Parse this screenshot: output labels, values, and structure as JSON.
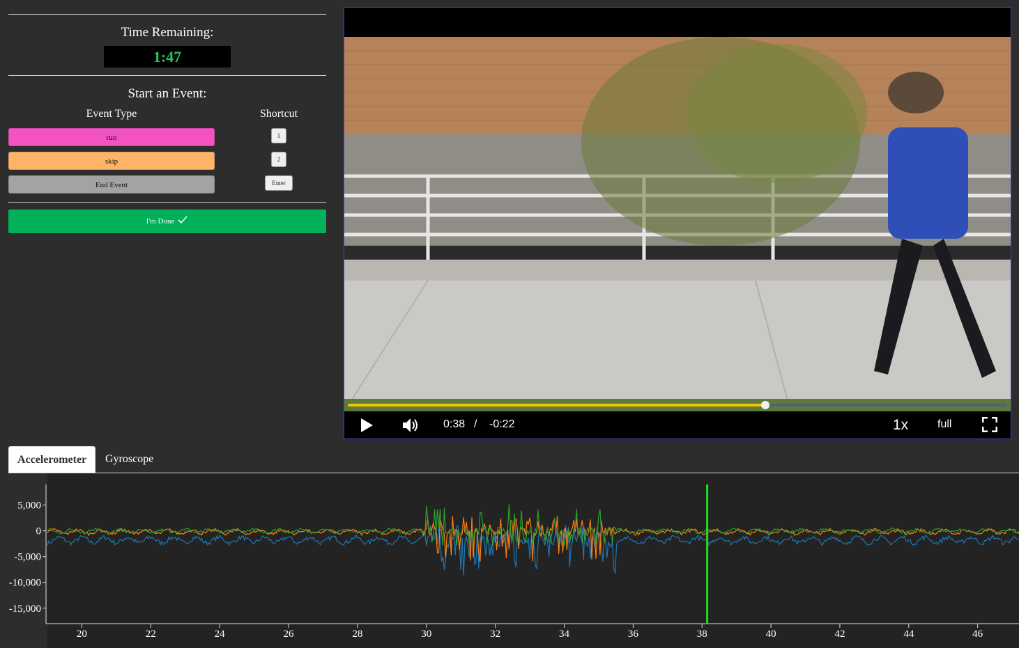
{
  "timer": {
    "title": "Time Remaining:",
    "value": "1:47"
  },
  "events": {
    "title": "Start an Event:",
    "col_type": "Event Type",
    "col_shortcut": "Shortcut",
    "items": [
      {
        "label": "run",
        "shortcut": "1",
        "color": "#f353c1"
      },
      {
        "label": "skip",
        "shortcut": "2",
        "color": "#fdb468"
      },
      {
        "label": "End Event",
        "shortcut": "Enter",
        "color": "#a3a3a3"
      }
    ]
  },
  "done": {
    "label": "I'm Done",
    "icon": "checkmark-icon",
    "color": "#00b159"
  },
  "video": {
    "elapsed": "0:38",
    "separator": "/",
    "remaining": "-0:22",
    "speed": "1x",
    "full_label": "full",
    "progress": 0.633,
    "icons": [
      "play-icon",
      "volume-icon",
      "fullscreen-icon"
    ]
  },
  "tabs": [
    {
      "label": "Accelerometer",
      "active": true
    },
    {
      "label": "Gyroscope",
      "active": false
    }
  ],
  "chart_data": {
    "type": "line",
    "title": "",
    "xlabel": "",
    "ylabel": "",
    "xlim": [
      19,
      47.2
    ],
    "ylim": [
      -18000,
      9000
    ],
    "xticks": [
      20,
      22,
      24,
      26,
      28,
      30,
      32,
      34,
      36,
      38,
      40,
      42,
      44,
      46
    ],
    "yticks": [
      5000,
      0,
      -5000,
      -10000,
      -15000
    ],
    "ytick_labels": [
      "5,000",
      "0",
      "-5,000",
      "-10,000",
      "-15,000"
    ],
    "cursor_x": 38.15,
    "cursor_color": "#22dd22",
    "grid": false,
    "series": [
      {
        "color": "#1f77b4",
        "baseline": -1800,
        "amplitude": 900,
        "burst_min": -9000,
        "burst_max": 1200
      },
      {
        "color": "#ff7f0e",
        "baseline": -200,
        "amplitude": 600,
        "burst_min": -6000,
        "burst_max": 3000
      },
      {
        "color": "#2ca02c",
        "baseline": 0,
        "amplitude": 500,
        "burst_min": -3000,
        "burst_max": 5500
      }
    ],
    "burst_range": [
      29.9,
      35.5
    ]
  }
}
